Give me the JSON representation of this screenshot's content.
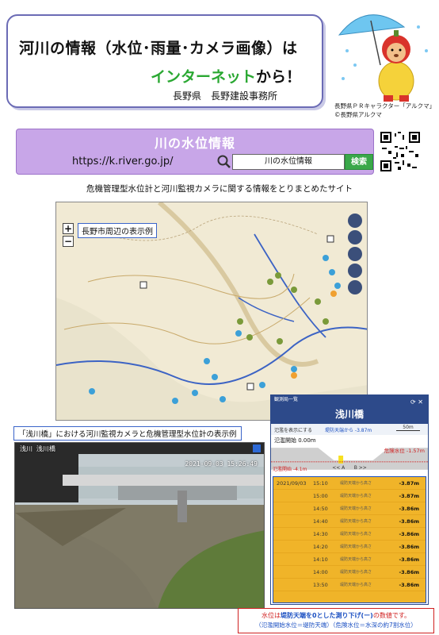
{
  "header": {
    "title_line1": "河川の情報（水位･雨量･カメラ画像）は",
    "title_line2_accent": "インターネット",
    "title_line2_rest": "から！",
    "organization": "長野県　長野建設事務所"
  },
  "mascot": {
    "caption_line1": "長野県ＰＲキャラクター「アルクマ」",
    "caption_line2": "©長野県アルクマ"
  },
  "band": {
    "title": "川の水位情報",
    "url": "https://k.river.go.jp/",
    "search_value": "川の水位情報",
    "search_button": "検索"
  },
  "subtitle": "危機管理型水位計と河川監視カメラに関する情報をとりまとめたサイト",
  "map": {
    "label": "長野市周辺の表示例"
  },
  "camera": {
    "caption": "「浅川橋」における河川監視カメラと危機管理型水位計の表示例",
    "overlay_label": "浅川 浅川橋",
    "timestamp": "2021-09-03 15:26:49"
  },
  "panel": {
    "top_bar": "観測局一覧",
    "title": "浅川橋",
    "strip_left": "氾濫を表示にする",
    "levee_text": "堤防天端から -3.87m",
    "scale_text": "50m",
    "flood_start": "氾濫開始 0.00m",
    "danger_text": "危険水位 -1.57m",
    "flood_line": "氾濫開始 -4.1m",
    "nav_prev": "<< A",
    "nav_next": "B >>",
    "rows": [
      {
        "date": "2021/09/03",
        "time": "15:10",
        "note": "堤防天端から高さ",
        "val": "-3.87m"
      },
      {
        "date": "",
        "time": "15:00",
        "note": "堤防天端から高さ",
        "val": "-3.87m"
      },
      {
        "date": "",
        "time": "14:50",
        "note": "堤防天端から高さ",
        "val": "-3.86m"
      },
      {
        "date": "",
        "time": "14:40",
        "note": "堤防天端から高さ",
        "val": "-3.86m"
      },
      {
        "date": "",
        "time": "14:30",
        "note": "堤防天端から高さ",
        "val": "-3.86m"
      },
      {
        "date": "",
        "time": "14:20",
        "note": "堤防天端から高さ",
        "val": "-3.86m"
      },
      {
        "date": "",
        "time": "14:10",
        "note": "堤防天端から高さ",
        "val": "-3.86m"
      },
      {
        "date": "",
        "time": "14:00",
        "note": "堤防天端から高さ",
        "val": "-3.86m"
      },
      {
        "date": "",
        "time": "13:50",
        "note": "堤防天端から高さ",
        "val": "-3.86m"
      }
    ]
  },
  "footnote": {
    "line1_a": "水位は",
    "line1_b": "堤防天端を0とした測り下げ(ー)",
    "line1_c": "の数値です。",
    "line2": "（氾濫開始水位＝堤防天端）（危険水位＝水深の約7割水位）"
  },
  "colors": {
    "band": "#c8a6e8",
    "accent_green": "#2aa832",
    "search_button": "#3aa84a",
    "panel_blue": "#2d4a8a",
    "table_yellow": "#f0b429"
  }
}
